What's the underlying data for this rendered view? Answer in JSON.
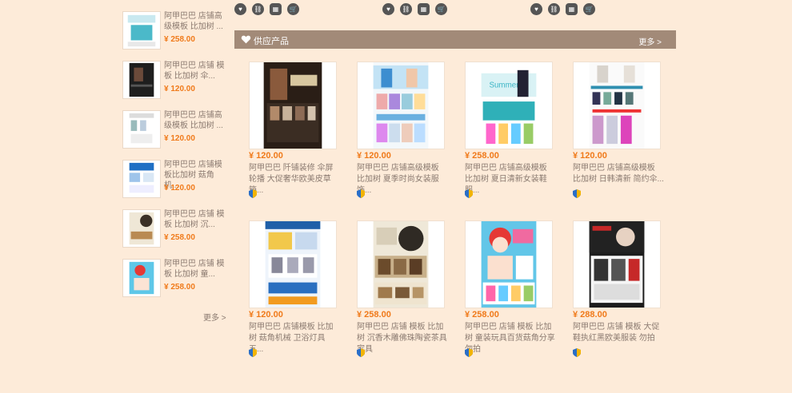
{
  "top_icons": {
    "heart_icon": "heart-icon",
    "link_icon": "link-icon",
    "qr_icon": "qrcode-icon",
    "cart_icon": "cart-icon"
  },
  "section": {
    "title": "供应产品",
    "more": "更多 >"
  },
  "sidebar": {
    "more": "更多 >",
    "items": [
      {
        "title": "阿甲巴巴 店铺高级模板 比加树 ...",
        "price": "¥ 258.00"
      },
      {
        "title": "阿甲巴巴 店铺 模板 比加树 伞...",
        "price": "¥ 120.00"
      },
      {
        "title": "阿甲巴巴 店铺高级模板 比加树 ...",
        "price": "¥ 120.00"
      },
      {
        "title": "阿甲巴巴 店铺模板比加树 菇角机...",
        "price": "¥ 120.00"
      },
      {
        "title": "阿甲巴巴 店铺 模板 比加树 沉...",
        "price": "¥ 258.00"
      },
      {
        "title": "阿甲巴巴 店铺 模板 比加树 童...",
        "price": "¥ 258.00"
      }
    ]
  },
  "products": [
    {
      "price": "¥ 120.00",
      "title": "阿甲巴巴 阡铺装修 伞屏轮播 大促奢华欧美皮草箱..."
    },
    {
      "price": "¥ 120.00",
      "title": "阿甲巴巴 店铺高级模板 比加树 夏季时尚女装服饰..."
    },
    {
      "price": "¥ 258.00",
      "title": "阿甲巴巴 店铺高级模板 比加树 夏日清新女装鞋服..."
    },
    {
      "price": "¥ 120.00",
      "title": "阿甲巴巴 店铺高级模板 比加树 日韩清新 简约伞..."
    },
    {
      "price": "¥ 120.00",
      "title": "阿甲巴巴 店铺模板 比加树 菇角机械 卫浴灯具 五..."
    },
    {
      "price": "¥ 258.00",
      "title": "阿甲巴巴 店铺 模板 比加树 沉香木雕佛珠陶瓷茶具家具"
    },
    {
      "price": "¥ 258.00",
      "title": "阿甲巴巴 店铺 模板 比加树 童装玩具百货菇角分享 勿拍"
    },
    {
      "price": "¥ 288.00",
      "title": "阿甲巴巴 店铺 模板 大促 鞋执红黑欧美服装 勿拍"
    }
  ],
  "colors": {
    "background": "#fdebd9",
    "header": "#a28a78",
    "price": "#f07a1a"
  }
}
